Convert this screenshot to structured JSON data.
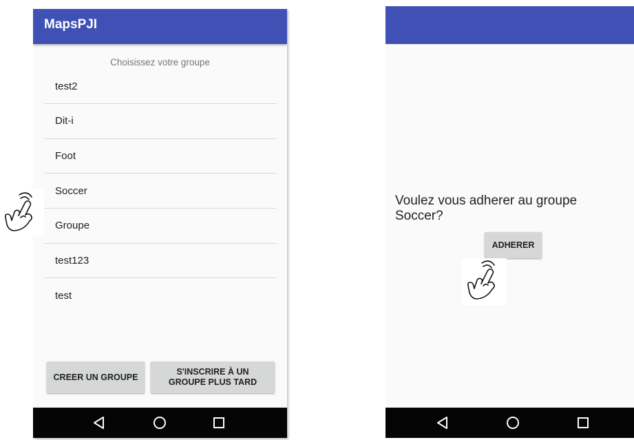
{
  "left_screen": {
    "app_title": "MapsPJI",
    "subtitle": "Choisissez votre groupe",
    "groups": [
      "test2",
      "Dit-i",
      "Foot",
      "Soccer",
      "Groupe",
      "test123",
      "test"
    ],
    "create_button": "CREER UN GROUPE",
    "later_button_line1": "S'INSCRIRE À UN",
    "later_button_line2": "GROUPE PLUS TARD"
  },
  "right_screen": {
    "prompt_line1": "Voulez vous adherer au groupe",
    "prompt_line2": "Soccer?",
    "join_button": "ADHERER"
  },
  "nav_icons": [
    "back-icon",
    "home-icon",
    "recents-icon"
  ],
  "colors": {
    "app_bar": "#3f51b5",
    "button": "#d6d7d7",
    "nav_bar": "#050505",
    "screen_background": "#fafafa"
  }
}
